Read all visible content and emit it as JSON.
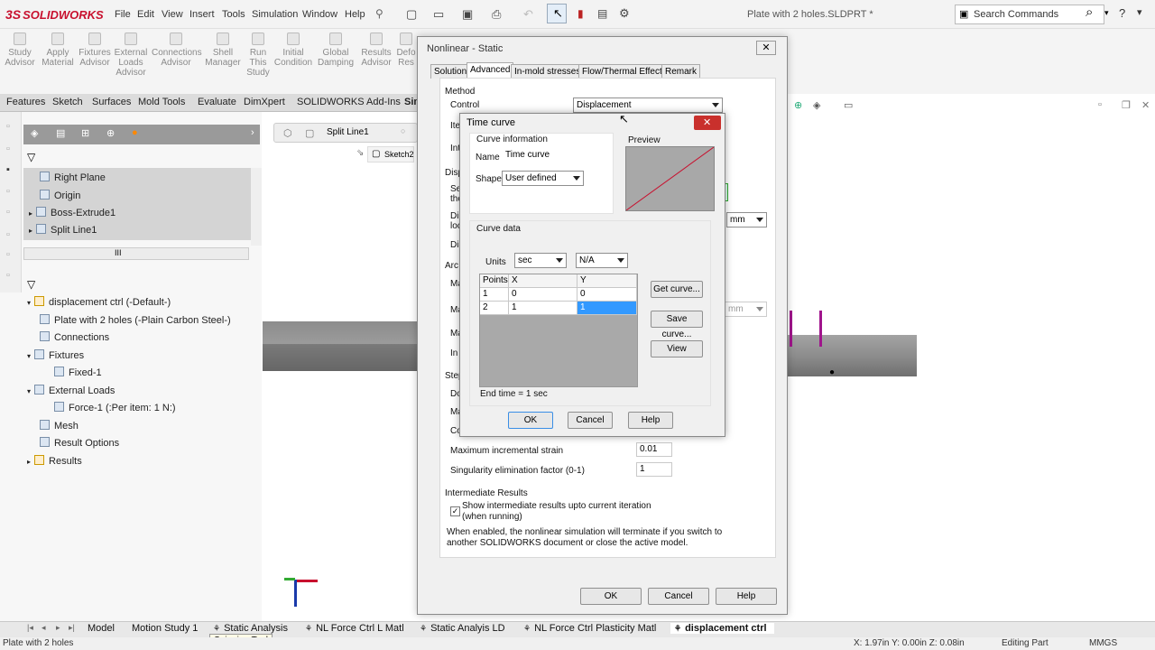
{
  "app": {
    "logo": "SOLIDWORKS",
    "menus": [
      "File",
      "Edit",
      "View",
      "Insert",
      "Tools",
      "Simulation",
      "Window",
      "Help"
    ],
    "doc_title": "Plate with 2 holes.SLDPRT *",
    "search_placeholder": "Search Commands"
  },
  "command_bar": [
    {
      "label": "Study\nAdvisor"
    },
    {
      "label": "Apply\nMaterial"
    },
    {
      "label": "Fixtures\nAdvisor"
    },
    {
      "label": "External\nLoads\nAdvisor"
    },
    {
      "label": "Connections\nAdvisor"
    },
    {
      "label": "Shell\nManager"
    },
    {
      "label": "Run\nThis\nStudy"
    },
    {
      "label": "Initial\nCondition"
    },
    {
      "label": "Global\nDamping"
    },
    {
      "label": "Results\nAdvisor"
    },
    {
      "label": "Defo\nRes"
    }
  ],
  "tabs": [
    "Features",
    "Sketch",
    "Surfaces",
    "Mold Tools",
    "Evaluate",
    "DimXpert",
    "SOLIDWORKS Add-Ins",
    "Sim"
  ],
  "feature_tree": [
    "Right Plane",
    "Origin",
    "Boss-Extrude1",
    "Split Line1"
  ],
  "scroll_glyph": "III",
  "study_tree": [
    "displacement ctrl (-Default-)",
    "Plate with 2 holes (-Plain Carbon Steel-)",
    "Connections",
    "Fixtures",
    "Fixed-1",
    "External Loads",
    "Force-1 (:Per item: 1 N:)",
    "Mesh",
    "Result Options",
    "Results"
  ],
  "breadcrumb": {
    "item": "Split Line1",
    "sketch": "Sketch2"
  },
  "main_dialog": {
    "title": "Nonlinear - Static",
    "tabs": [
      "Solution",
      "Advanced",
      "In-mold stresses",
      "Flow/Thermal Effects",
      "Remark"
    ],
    "method_label": "Method",
    "control_label": "Control",
    "control_value": "Displacement",
    "partial_labels": [
      "Ite",
      "Int",
      "Disp",
      "Se\nthe",
      "Di\nloc",
      "Dis",
      "Arc",
      "Ma",
      "Ma",
      "Ma",
      "In",
      "Step",
      "Do",
      "Ma",
      "Co"
    ],
    "unit_value": "mm",
    "unit_value_faded": "mm",
    "max_strain_label": "Maximum incremental strain",
    "max_strain_value": "0.01",
    "singularity_label": "Singularity elimination factor (0-1)",
    "singularity_value": "1",
    "intermediate_label": "Intermediate Results",
    "intermediate_check": "Show intermediate results upto current iteration\n(when running)",
    "intermediate_note": "When enabled, the nonlinear simulation will terminate if you switch to another SOLIDWORKS document or close the active model.",
    "ok": "OK",
    "cancel": "Cancel",
    "help": "Help"
  },
  "time_curve": {
    "title": "Time curve",
    "curve_info_label": "Curve information",
    "name_label": "Name",
    "name_value": "Time curve",
    "shape_label": "Shape",
    "shape_value": "User defined",
    "preview_label": "Preview",
    "curve_data_label": "Curve data",
    "units_label": "Units",
    "unit_x": "sec",
    "unit_y": "N/A",
    "columns": [
      "Points",
      "X",
      "Y"
    ],
    "rows": [
      {
        "point": "1",
        "x": "0",
        "y": "0"
      },
      {
        "point": "2",
        "x": "1",
        "y": "1"
      }
    ],
    "end_time": "End time = 1 sec",
    "get_curve": "Get curve...",
    "save_curve": "Save curve...",
    "view": "View",
    "ok": "OK",
    "cancel": "Cancel",
    "help": "Help",
    "accent": "#c8102e",
    "selection": "#3399ff"
  },
  "bottom_tabs": [
    "Model",
    "Motion Study 1",
    "Static Analysis",
    "NL Force Ctrl L Matl",
    "Static Analyis LD",
    "NL Force Ctrl Plasticity Matl",
    "displacement ctrl"
  ],
  "tooltip": "Snipping Tool",
  "status": {
    "left": "Plate with 2 holes",
    "coords": "X: 1.97in Y: 0.00in Z: 0.08in",
    "mode": "Editing Part",
    "units": "MMGS"
  }
}
